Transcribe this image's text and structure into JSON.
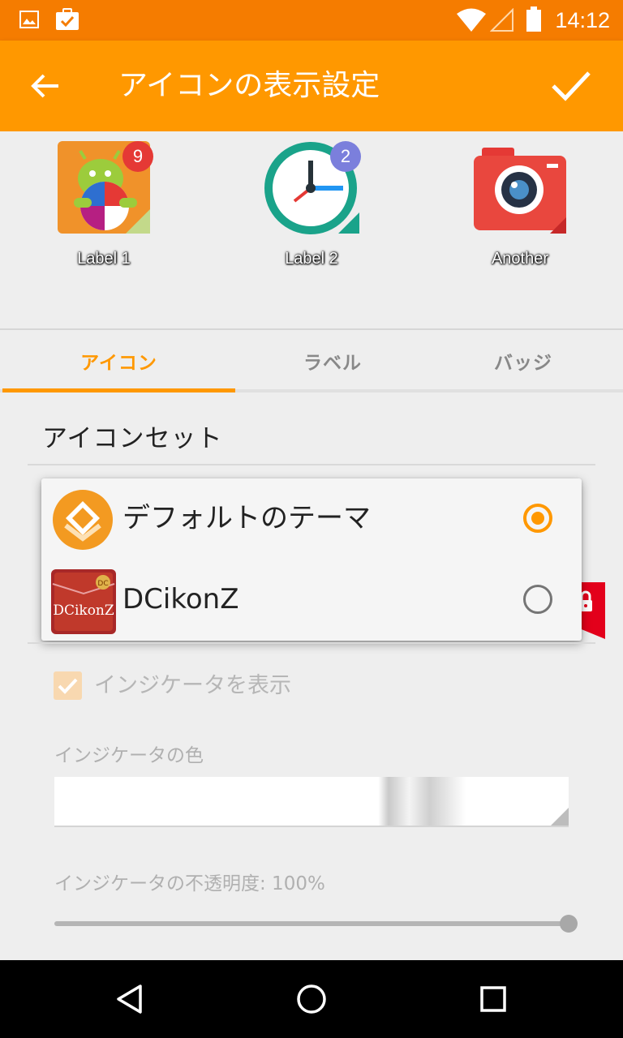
{
  "status_bar": {
    "time": "14:12",
    "icons": [
      "image-icon",
      "clipboard-check-icon",
      "wifi-icon",
      "signal-icon",
      "battery-icon"
    ]
  },
  "app_bar": {
    "title": "アイコンの表示設定",
    "back_icon": "arrow-left-icon",
    "confirm_icon": "check-icon"
  },
  "preview": {
    "items": [
      {
        "label": "Label 1",
        "badge": "9",
        "badge_color": "#e53935",
        "icon": "android-beach-ball-icon"
      },
      {
        "label": "Label 2",
        "badge": "2",
        "badge_color": "#7b7fdc",
        "icon": "clock-icon"
      },
      {
        "label": "Another",
        "icon": "camera-icon"
      }
    ]
  },
  "tabs": [
    {
      "label": "アイコン",
      "active": true
    },
    {
      "label": "ラベル",
      "active": false
    },
    {
      "label": "バッジ",
      "active": false
    }
  ],
  "icon_set": {
    "title": "アイコンセット",
    "options": [
      {
        "label": "デフォルトのテーマ",
        "selected": true,
        "icon": "default-theme-icon"
      },
      {
        "label": "DCikonZ",
        "selected": false,
        "icon": "dcikonz-icon",
        "icon_text": "DCikonZ"
      }
    ]
  },
  "indicator": {
    "show_label": "インジケータを表示",
    "show_checked": true,
    "color_label": "インジケータの色",
    "opacity_label": "インジケータの不透明度: 100%",
    "opacity": 1.0
  },
  "colors": {
    "status_bar": "#f57c00",
    "app_bar": "#ff9800",
    "accent": "#ff9800"
  },
  "nav_bar": {
    "buttons": [
      "back-triangle-icon",
      "home-circle-icon",
      "recents-square-icon"
    ]
  }
}
